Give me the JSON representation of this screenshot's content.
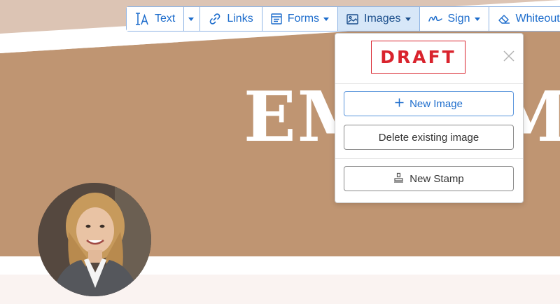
{
  "document": {
    "title_text": "EM",
    "title_text_right": "MA"
  },
  "toolbar": {
    "text_label": "Text",
    "links_label": "Links",
    "forms_label": "Forms",
    "images_label": "Images",
    "sign_label": "Sign",
    "whiteout_label": "Whiteout"
  },
  "images_menu": {
    "stamp_preview_text": "DRAFT",
    "new_image_label": "New Image",
    "delete_image_label": "Delete existing image",
    "new_stamp_label": "New Stamp"
  },
  "colors": {
    "accent": "#1c6ccc",
    "toolbar_border": "#8fb4e4",
    "active_tab_bg": "#d7e7f8",
    "stamp_red": "#d9232d",
    "banner_tan": "#bf9572"
  },
  "icons": {
    "text": "text-cursor-icon",
    "links": "link-icon",
    "forms": "form-icon",
    "images": "image-icon",
    "sign": "signature-icon",
    "whiteout": "eraser-icon",
    "close": "close-icon",
    "new_image": "plus-icon",
    "new_stamp": "stamp-icon"
  }
}
